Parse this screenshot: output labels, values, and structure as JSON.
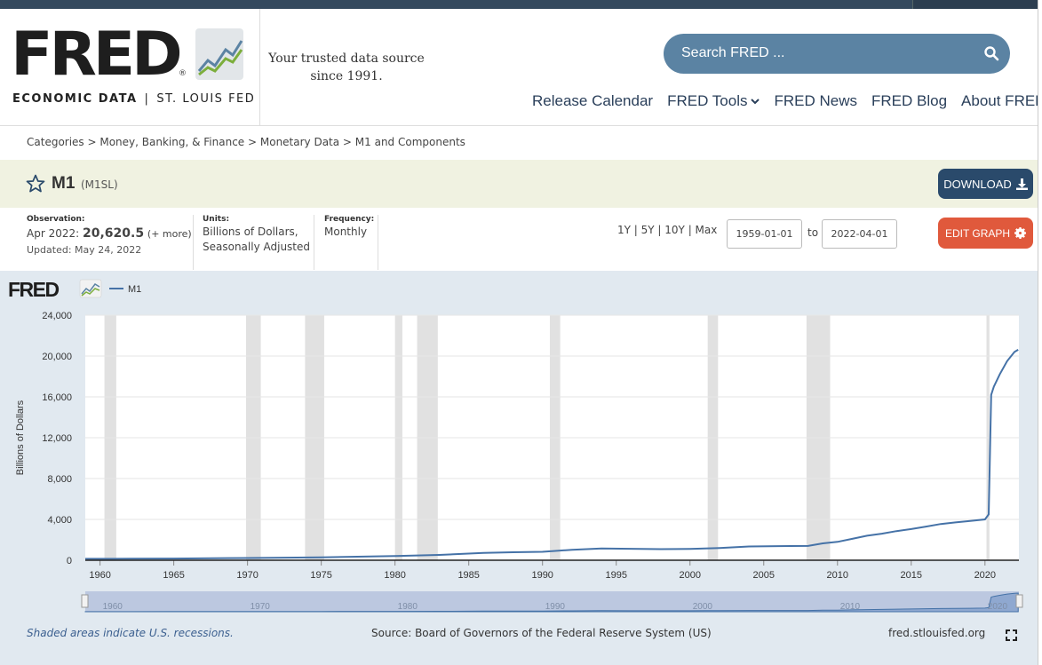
{
  "header": {
    "logo_word": "FRED",
    "logo_reg": "®",
    "logo_sub_left": "ECONOMIC DATA",
    "logo_sub_sep": "|",
    "logo_sub_right": "ST. LOUIS FED",
    "tagline": "Your trusted data source since 1991.",
    "search_placeholder": "Search FRED ...",
    "nav": [
      "Release Calendar",
      "FRED Tools",
      "FRED News",
      "FRED Blog",
      "About FRED"
    ]
  },
  "breadcrumb": "Categories > Money, Banking, & Finance > Monetary Data > M1 and Components",
  "series": {
    "name": "M1",
    "id": "(M1SL)",
    "download_label": "DOWNLOAD"
  },
  "meta": {
    "observation_label": "Observation:",
    "observation_date": "Apr 2022:",
    "observation_value": "20,620.5",
    "observation_more": "(+ more)",
    "updated": "Updated: May 24, 2022",
    "units_label": "Units:",
    "units_line1": "Billions of Dollars,",
    "units_line2": "Seasonally Adjusted",
    "frequency_label": "Frequency:",
    "frequency_value": "Monthly",
    "ranges": "1Y | 5Y | 10Y | Max",
    "start_date": "1959-01-01",
    "to_label": "to",
    "end_date": "2022-04-01",
    "edit_label": "EDIT GRAPH"
  },
  "chart_data": {
    "type": "line",
    "legend_logo": "FRED",
    "series": [
      {
        "name": "M1",
        "color": "#4572a7"
      }
    ],
    "ylabel": "Billions of Dollars",
    "ylim": [
      0,
      24000
    ],
    "yticks": [
      "0",
      "4,000",
      "8,000",
      "12,000",
      "16,000",
      "20,000",
      "24,000"
    ],
    "xlim": [
      1959.0,
      2022.3
    ],
    "xticks": [
      "1960",
      "1965",
      "1970",
      "1975",
      "1980",
      "1985",
      "1990",
      "1995",
      "2000",
      "2005",
      "2010",
      "2015",
      "2020"
    ],
    "x": [
      1959.0,
      1962.0,
      1965.0,
      1970.0,
      1975.0,
      1980.0,
      1983.0,
      1986.0,
      1988.0,
      1990.0,
      1992.0,
      1994.0,
      1996.0,
      1998.0,
      2000.0,
      2001.0,
      2002.0,
      2004.0,
      2006.0,
      2008.0,
      2009.0,
      2010.0,
      2011.0,
      2012.0,
      2013.0,
      2014.0,
      2015.0,
      2016.0,
      2017.0,
      2018.0,
      2019.0,
      2020.0,
      2020.25,
      2020.42,
      2020.6,
      2021.0,
      2021.5,
      2022.0,
      2022.25
    ],
    "values": [
      139,
      145,
      167,
      214,
      287,
      408,
      524,
      725,
      786,
      825,
      1025,
      1150,
      1120,
      1090,
      1110,
      1150,
      1200,
      1350,
      1380,
      1400,
      1650,
      1800,
      2100,
      2400,
      2600,
      2850,
      3050,
      3300,
      3550,
      3700,
      3850,
      4000,
      4500,
      16200,
      17000,
      18200,
      19500,
      20400,
      20620
    ],
    "recessions": [
      [
        1960.3,
        1961.1
      ],
      [
        1969.9,
        1970.9
      ],
      [
        1973.9,
        1975.2
      ],
      [
        1980.0,
        1980.5
      ],
      [
        1981.5,
        1982.9
      ],
      [
        1990.5,
        1991.2
      ],
      [
        2001.2,
        2001.9
      ],
      [
        2007.9,
        2009.5
      ],
      [
        2020.1,
        2020.3
      ]
    ],
    "navigator_labels": [
      "1960",
      "1970",
      "1980",
      "1990",
      "2000",
      "2010",
      "2020"
    ]
  },
  "footer": {
    "recession_note": "Shaded areas indicate U.S. recessions.",
    "source": "Source: Board of Governors of the Federal Reserve System (US)",
    "url": "fred.stlouisfed.org"
  }
}
